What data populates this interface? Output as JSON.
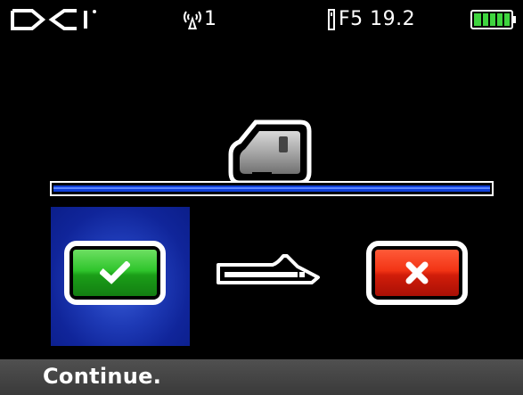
{
  "status_bar": {
    "brand_icon": "dci-logo",
    "signal_icon": "antenna-icon",
    "signal_channel": "1",
    "frequency_icon": "transmitter-icon",
    "frequency_label": "F5 19.2",
    "battery_icon": "battery-full-icon",
    "battery_level": 1.0
  },
  "screen": {
    "receiver_icon": "receiver-icon",
    "tool_icon": "transmitter-housing-icon",
    "confirm_icon": "checkmark-icon",
    "cancel_icon": "x-icon",
    "selected_option": "confirm"
  },
  "message": {
    "text": "Continue."
  },
  "colors": {
    "highlight": "#1630a8",
    "confirm": "#2fc52c",
    "cancel": "#e02a10",
    "line": "#1040d8",
    "battery": "#3fd53f"
  }
}
